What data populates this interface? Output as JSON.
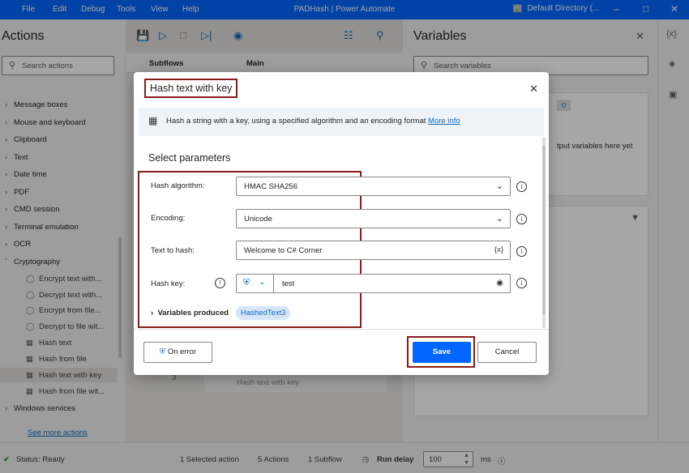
{
  "titlebar": {
    "menus": [
      "File",
      "Edit",
      "Debug",
      "Tools",
      "View",
      "Help"
    ],
    "title": "PADHash | Power Automate",
    "environment": "Default Directory (...",
    "icons": [
      "environment-icon",
      "minimize-icon",
      "maximize-icon",
      "close-icon"
    ]
  },
  "actions": {
    "title": "Actions",
    "search_placeholder": "Search actions",
    "categories": [
      {
        "label": "Message boxes"
      },
      {
        "label": "Mouse and keyboard"
      },
      {
        "label": "Clipboard"
      },
      {
        "label": "Text"
      },
      {
        "label": "Date time"
      },
      {
        "label": "PDF"
      },
      {
        "label": "CMD session"
      },
      {
        "label": "Terminal emulation"
      },
      {
        "label": "OCR"
      },
      {
        "label": "Cryptography"
      }
    ],
    "crypto_items": [
      {
        "label": "Encrypt text with..."
      },
      {
        "label": "Decrypt text with..."
      },
      {
        "label": "Encrypt from file..."
      },
      {
        "label": "Decrypt to file wit..."
      },
      {
        "label": "Hash text"
      },
      {
        "label": "Hash from file"
      },
      {
        "label": "Hash text with key"
      },
      {
        "label": "Hash from file wit..."
      }
    ],
    "windows_services": "Windows services",
    "see_more": "See more actions"
  },
  "center": {
    "subflows_tab": "Subflows",
    "main_tab": "Main",
    "ghost_step": "Hash text with key",
    "ghost_num": "3"
  },
  "variables": {
    "title": "Variables",
    "search_placeholder": "Search variables",
    "count": "0",
    "empty_text": "tput variables here yet"
  },
  "dialog": {
    "title": "Hash text with key",
    "description": "Hash a string with a key, using a specified algorithm and an encoding format",
    "more_info": "More info",
    "section": "Select parameters",
    "hash_algorithm_label": "Hash algorithm:",
    "hash_algorithm_value": "HMAC SHA256",
    "encoding_label": "Encoding:",
    "encoding_value": "Unicode",
    "text_label": "Text to hash:",
    "text_value": "Welcome to C# Corner",
    "text_var_icon": "{x}",
    "key_label": "Hash key:",
    "key_value": "test",
    "variables_produced": "Variables produced",
    "produced_var": "HashedText3",
    "on_error": "On error",
    "save": "Save",
    "cancel": "Cancel"
  },
  "status": {
    "state": "Status: Ready",
    "selected": "1 Selected action",
    "actions": "5 Actions",
    "subflow": "1 Subflow",
    "run_delay_label": "Run delay",
    "run_delay_value": "100",
    "unit": "ms"
  },
  "colors": {
    "accent": "#0066ff",
    "highlight_box": "#8b1a1a"
  }
}
